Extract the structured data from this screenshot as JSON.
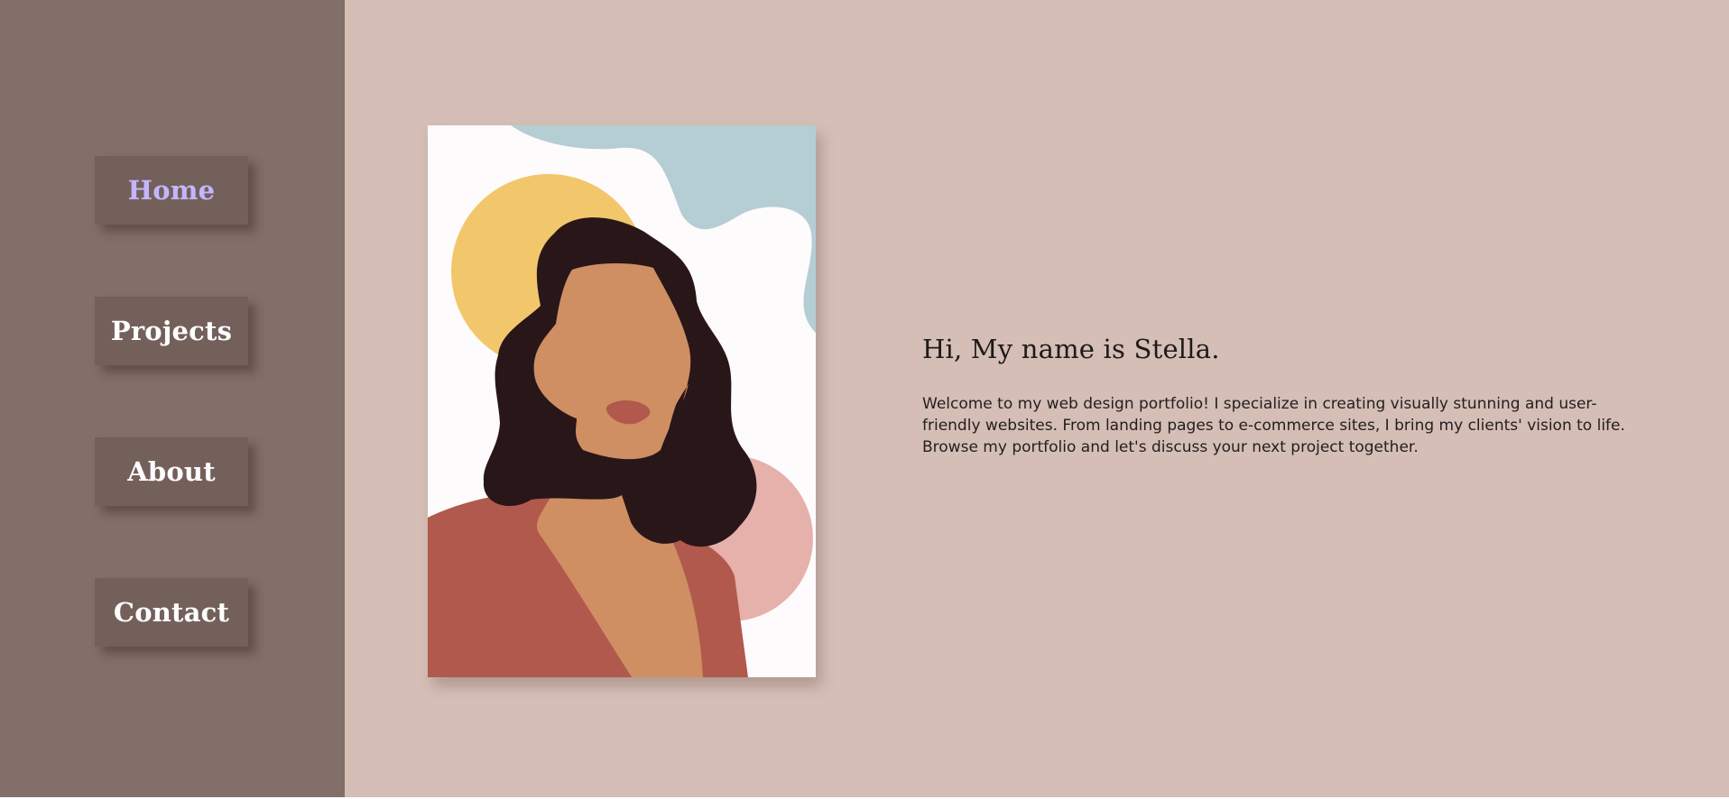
{
  "nav": {
    "items": [
      {
        "label": "Home",
        "active": true
      },
      {
        "label": "Projects",
        "active": false
      },
      {
        "label": "About",
        "active": false
      },
      {
        "label": "Contact",
        "active": false
      }
    ],
    "active_color": "#c3b6ff"
  },
  "hero": {
    "heading": "Hi, My name is Stella.",
    "bio": "Welcome to my web design portfolio! I specialize in creating visually stunning and user-friendly websites. From landing pages to e-commerce sites, I bring my clients' vision to life. Browse my portfolio and let's discuss your next project together."
  },
  "colors": {
    "sidebar": "#836f69",
    "nav_button": "#74605b",
    "main_bg": "#d4beb6"
  }
}
